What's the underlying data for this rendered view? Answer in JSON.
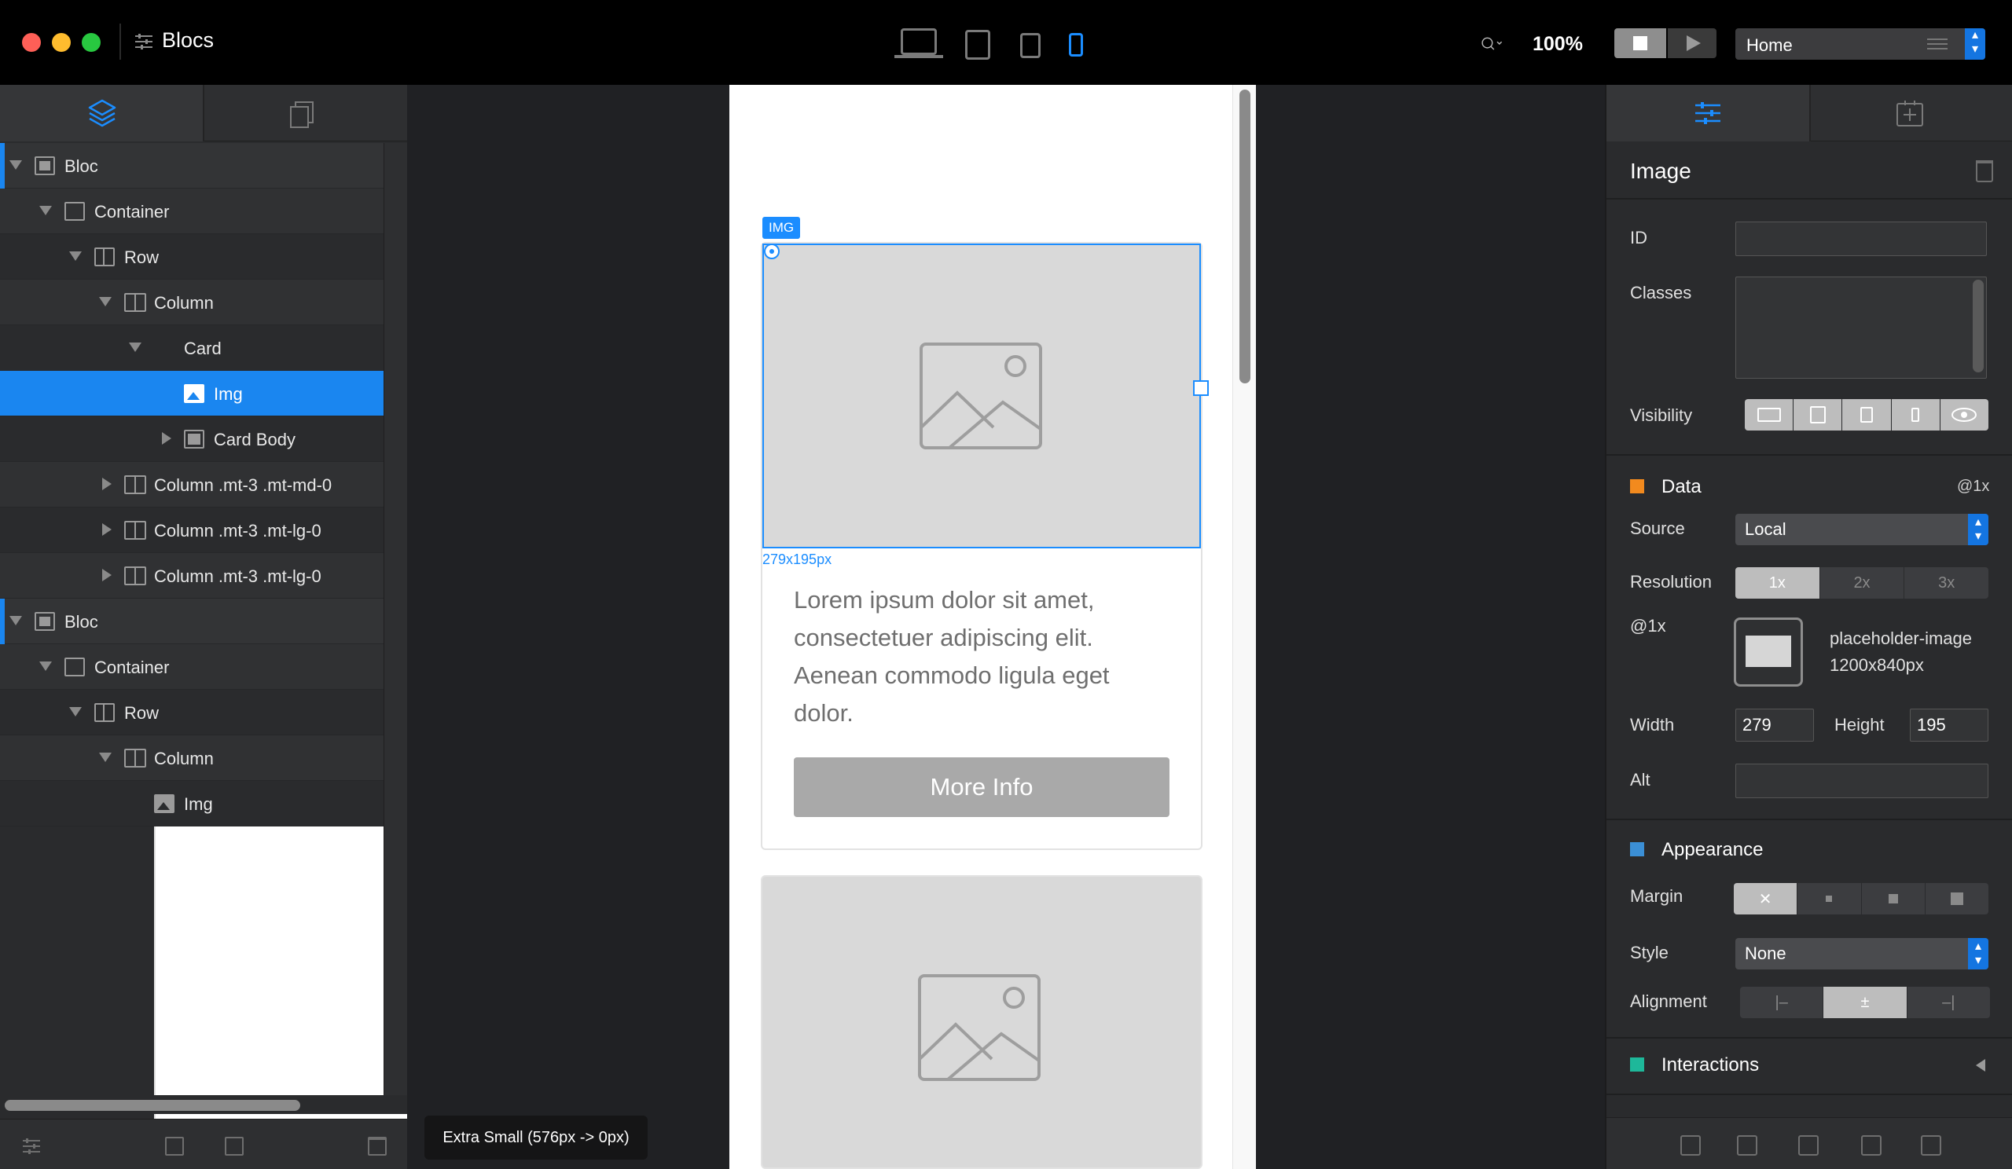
{
  "app": {
    "title": "Blocs"
  },
  "toolbar": {
    "zoom": "100%",
    "page_select": "Home"
  },
  "layers": [
    {
      "label": "Bloc",
      "level": 0,
      "toggle": "down",
      "icon": "bloc-icon"
    },
    {
      "label": "Container",
      "level": 1,
      "toggle": "down",
      "icon": "container-icon"
    },
    {
      "label": "Row",
      "level": 2,
      "toggle": "down",
      "icon": "row-icon"
    },
    {
      "label": "Column",
      "level": 3,
      "toggle": "down",
      "icon": "column-icon"
    },
    {
      "label": "Card",
      "level": 4,
      "toggle": "down",
      "icon": "card-icon"
    },
    {
      "label": "Img",
      "level": 5,
      "toggle": "none",
      "icon": "image-icon",
      "selected": true
    },
    {
      "label": "Card Body",
      "level": 5,
      "toggle": "right",
      "icon": "card-body-icon"
    },
    {
      "label": "Column .mt-3 .mt-md-0",
      "level": 3,
      "toggle": "right",
      "icon": "column-icon"
    },
    {
      "label": "Column .mt-3 .mt-lg-0",
      "level": 3,
      "toggle": "right",
      "icon": "column-icon"
    },
    {
      "label": "Column .mt-3 .mt-lg-0",
      "level": 3,
      "toggle": "right",
      "icon": "column-icon"
    },
    {
      "label": "Bloc",
      "level": 0,
      "toggle": "down",
      "icon": "bloc-icon"
    },
    {
      "label": "Container",
      "level": 1,
      "toggle": "down",
      "icon": "container-icon"
    },
    {
      "label": "Row",
      "level": 2,
      "toggle": "down",
      "icon": "row-icon"
    },
    {
      "label": "Column",
      "level": 3,
      "toggle": "down",
      "icon": "column-icon"
    },
    {
      "label": "Img",
      "level": 4,
      "toggle": "none",
      "icon": "image-icon"
    }
  ],
  "canvas": {
    "breakpoint_label": "Extra Small (576px -> 0px)",
    "img_tag": "IMG",
    "img_size": "279x195px",
    "card_text": "Lorem ipsum dolor sit amet, consectetuer adipiscing elit. Aenean commodo ligula eget dolor.",
    "button_label": "More Info"
  },
  "inspector": {
    "title": "Image",
    "id_label": "ID",
    "id_value": "",
    "classes_label": "Classes",
    "classes_value": "",
    "visibility_label": "Visibility",
    "data_section": "Data",
    "data_badge": "@1x",
    "source_label": "Source",
    "source_value": "Local",
    "resolution_label": "Resolution",
    "resolution_options": [
      "1x",
      "2x",
      "3x"
    ],
    "resolution_selected": "1x",
    "at1x_label": "@1x",
    "image_name": "placeholder-image",
    "image_dims": "1200x840px",
    "width_label": "Width",
    "width_value": "279",
    "height_label": "Height",
    "height_value": "195",
    "alt_label": "Alt",
    "alt_value": "",
    "appearance_section": "Appearance",
    "margin_label": "Margin",
    "style_label": "Style",
    "style_value": "None",
    "alignment_label": "Alignment",
    "interactions_section": "Interactions"
  },
  "colors": {
    "accent": "#1a86f0",
    "data_section": "#f28a1e",
    "appearance_section": "#3b8fd6",
    "interactions_section": "#1eb89a"
  }
}
